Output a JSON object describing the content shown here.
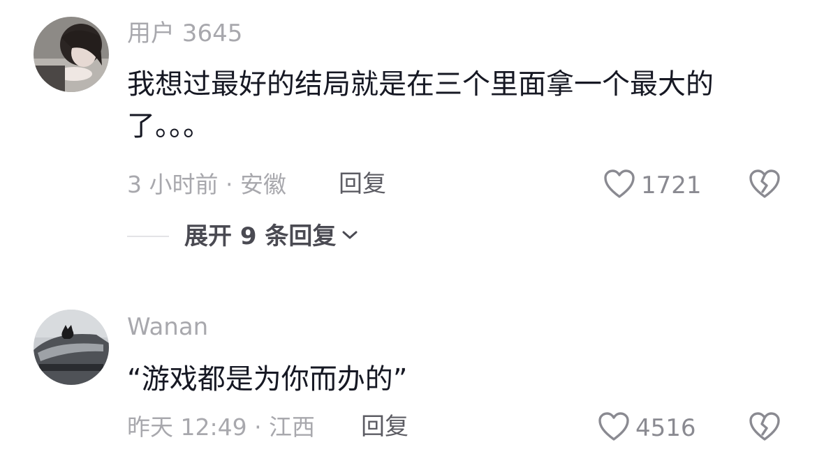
{
  "comments": [
    {
      "username": "用户 3645",
      "text": "我想过最好的结局就是在三个里面拿一个最大的了。。。",
      "meta": "3 小时前 · 安徽",
      "reply_label": "回复",
      "likes": "1721",
      "expand_label": "展开 9 条回复"
    },
    {
      "username": "Wanan",
      "text": "“游戏都是为你而办的”",
      "meta": "昨天 12:49 · 江西",
      "reply_label": "回复",
      "likes": "4516"
    }
  ],
  "colors": {
    "text_primary": "#161823",
    "text_secondary": "#a8a8ad",
    "icon_gray": "#8a8a91"
  },
  "icons": [
    "avatar",
    "heart-icon",
    "broken-heart-icon",
    "chevron-down-icon"
  ]
}
